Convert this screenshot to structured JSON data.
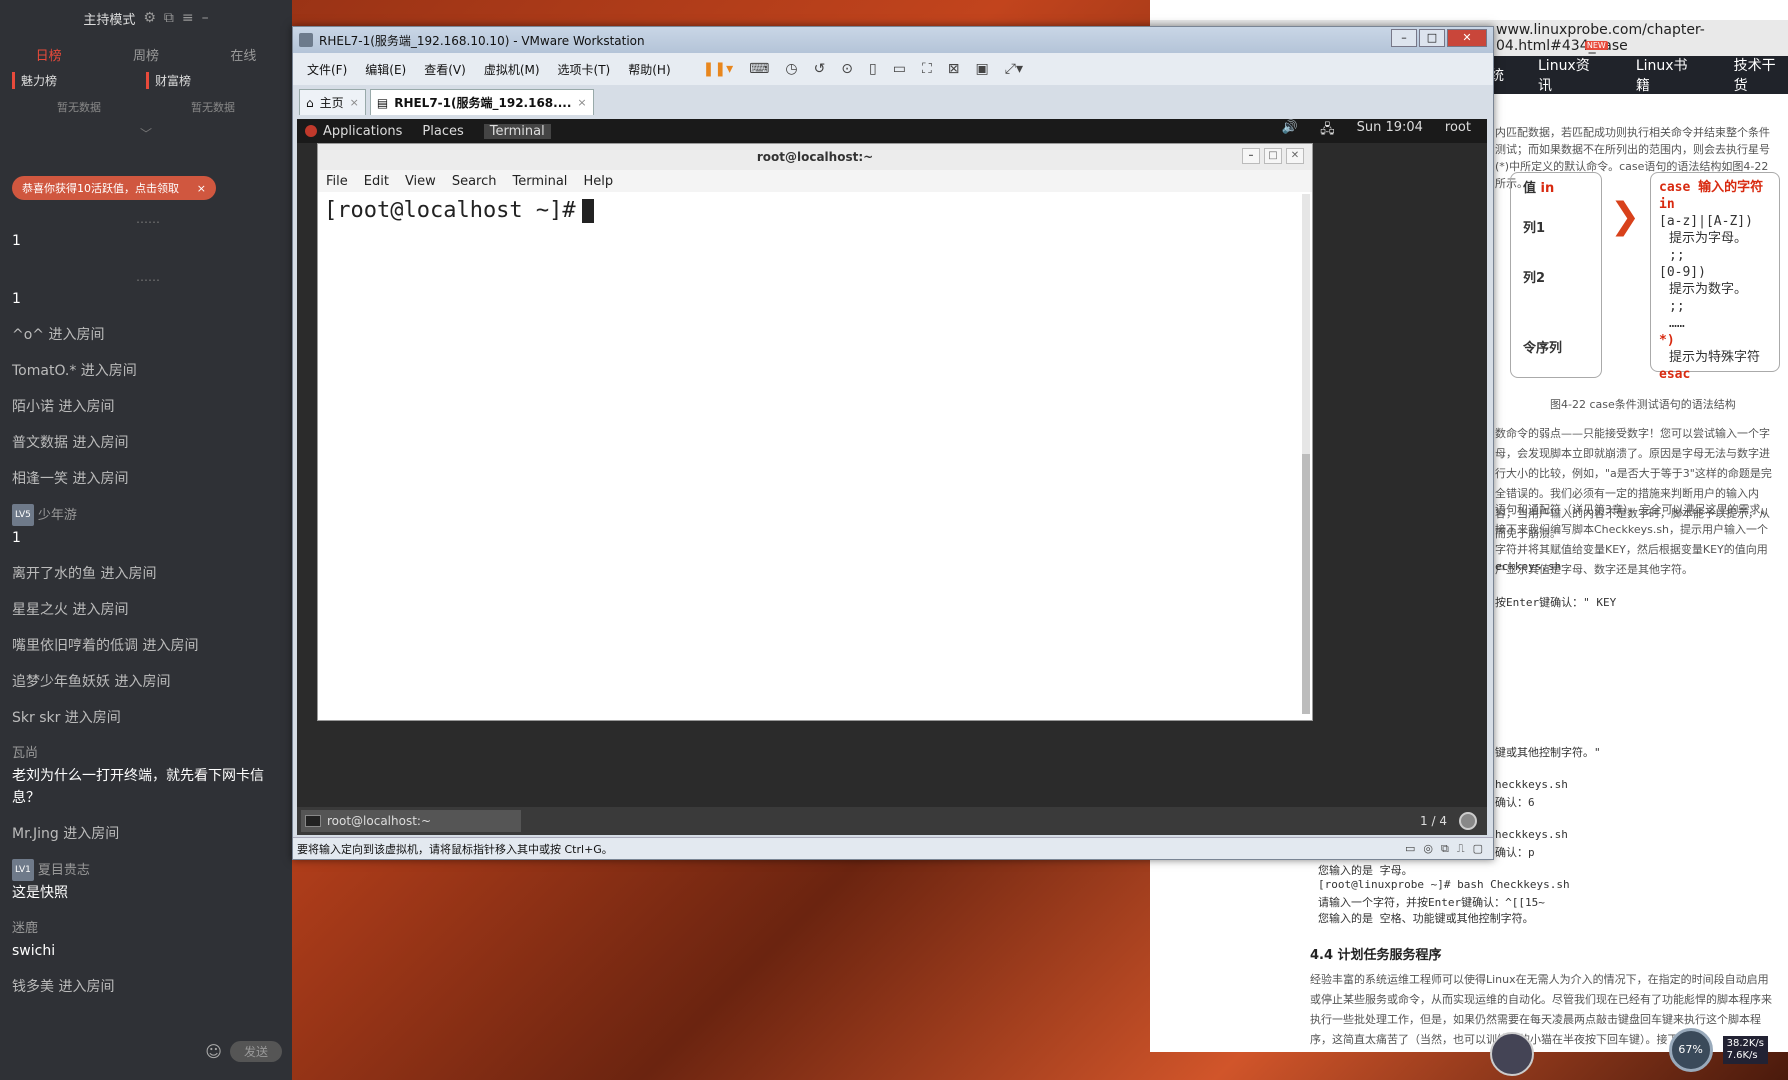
{
  "chat": {
    "host_mode": "主持模式",
    "tabs": [
      "日榜",
      "周榜",
      "在线"
    ],
    "ranks": [
      {
        "title": "魅力榜",
        "empty": "暂无数据"
      },
      {
        "title": "财富榜",
        "empty": "暂无数据"
      }
    ],
    "toast": "恭喜你获得10活跃值，点击领取",
    "toast_close": "×",
    "messages": [
      {
        "dots": "……",
        "text": "1"
      },
      {
        "dots": "……",
        "text": "1"
      },
      {
        "text": "^o^ 进入房间"
      },
      {
        "text": "TomatO.* 进入房间"
      },
      {
        "text": "陌小诺 进入房间"
      },
      {
        "text": "普文数据 进入房间"
      },
      {
        "text": "相逢一笑 进入房间"
      },
      {
        "level": "LV5",
        "nick": "少年游",
        "text": "1"
      },
      {
        "text": "离开了水的鱼 进入房间"
      },
      {
        "text": "星星之火 进入房间"
      },
      {
        "text": "嘴里依旧哼着的低调 进入房间"
      },
      {
        "text": "追梦少年鱼妖妖 进入房间"
      },
      {
        "text": "Skr skr 进入房间"
      },
      {
        "nick": "瓦尚",
        "text": "老刘为什么一打开终端，就先看下网卡信息？"
      },
      {
        "text": "Mr.Jing 进入房间"
      },
      {
        "level": "LV1",
        "nick": "夏目贵志",
        "text": "这是快照"
      },
      {
        "nick": "迷鹿",
        "text": "swichi"
      },
      {
        "text": "钱多美 进入房间"
      }
    ],
    "send_label": "发送"
  },
  "vmware": {
    "title": "RHEL7-1(服务端_192.168.10.10) - VMware Workstation",
    "menu": [
      "文件(F)",
      "编辑(E)",
      "查看(V)",
      "虚拟机(M)",
      "选项卡(T)",
      "帮助(H)"
    ],
    "tabs": [
      {
        "label": "主页",
        "close": "×"
      },
      {
        "label": "RHEL7-1(服务端_192.168....",
        "close": "×"
      }
    ],
    "status_hint": "要将输入定向到该虚拟机，请将鼠标指针移入其中或按 Ctrl+G。"
  },
  "gnome": {
    "applications": "Applications",
    "places": "Places",
    "terminal_app": "Terminal",
    "clock": "Sun 19:04",
    "user": "root"
  },
  "terminal": {
    "title": "root@localhost:~",
    "menu": [
      "File",
      "Edit",
      "View",
      "Search",
      "Terminal",
      "Help"
    ],
    "prompt": "[root@localhost ~]#"
  },
  "guest_taskbar": {
    "item": "root@localhost:~",
    "pager": "1 / 4"
  },
  "browser": {
    "url": "www.linuxprobe.com/chapter-04.html#434_case",
    "url_tail": "",
    "nav": [
      "统",
      "Linux资讯",
      "Linux书籍",
      "技术干货"
    ],
    "intro": "内匹配数据，若匹配成功则执行相关命令并结束整个条件测试；而如果数据不在所列出的范围内，则会去执行星号(*)中所定义的默认命令。case语句的语法结构如图4-22所示。",
    "caption": "图4-22  case条件测试语句的语法结构",
    "para1": "数命令的弱点——只能接受数字！您可以尝试输入一个字母，会发现脚本立即就崩溃了。原因是字母无法与数字进行大小的比较，例如，\"a是否大于等于3\"这样的命题是完全错误的。我们必须有一定的措施来判断用户的输入内容，当用户输入的内容不是数字时，脚本能予以提示，从而免于崩溃。",
    "para2": "语句和通配符（详见第3章），完全可以满足这里的需求。接下来我们编写脚本Checkkeys.sh，提示用户输入一个字符并将其赋值给变量KEY，然后根据变量KEY的值向用户显示其值是字母、数字还是其他字符。",
    "box_left": [
      "值",
      "in",
      "列1",
      "列2",
      "令序列"
    ],
    "box_right": [
      "case 输入的字符 in",
      "[a-z]|[A-Z])",
      "提示为字母。",
      ";;",
      "[0-9])",
      "提示为数字。",
      ";;",
      "……",
      "*)",
      "提示为特殊字符",
      "esac"
    ],
    "code1": "eckkeys.sh",
    "code2": "按Enter键确认：\" KEY",
    "code3": "键或其他控制字符。\"",
    "code4": "heckkeys.sh",
    "code5": "确认：6",
    "code6": "heckkeys.sh",
    "code7": "确认：p",
    "code8": "您输入的是 字母。",
    "code9": "[root@linuxprobe ~]# bash Checkkeys.sh",
    "code10": "请输入一个字符，并按Enter键确认：^[[15~",
    "code11": "您输入的是 空格、功能键或其他控制字符。",
    "section": "4.4 计划任务服务程序",
    "para3": "经验丰富的系统运维工程师可以使得Linux在无需人为介入的情况下，在指定的时间段自动启用或停止某些服务或命令，从而实现运维的自动化。尽管我们现在已经有了功能彪悍的脚本程序来执行一些批处理工作，但是，如果仍然需要在每天凌晨两点敲击键盘回车键来执行这个脚本程序，这简直太痛苦了（当然，也可以训练您的小猫在半夜按下回车键）。接下来"
  },
  "overlay": {
    "cpu": "67%",
    "up": "38.2K/s",
    "down": "7.6K/s"
  }
}
